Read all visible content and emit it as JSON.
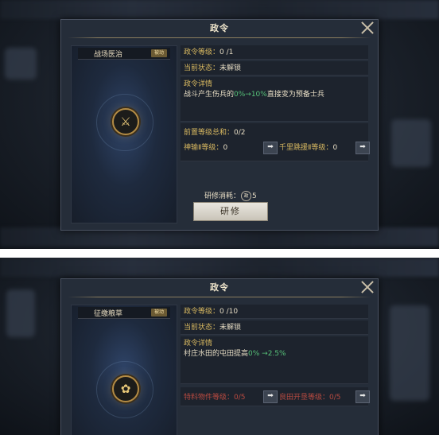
{
  "top": {
    "window_title": "政令",
    "policy_name": "战场医治",
    "policy_badge": "被动",
    "level_label": "政令等级：",
    "level_value": "0 /1",
    "status_label": "当前状态：",
    "status_value": "未解锁",
    "details_label": "政令详情",
    "details_prefix": "战斗产生伤兵的",
    "details_range": "0%→10%",
    "details_suffix": "直接变为预备士兵",
    "prereq_label": "前置等级总和：",
    "prereq_value": "0/2",
    "prereq1_label": "神输Ⅱ等级：",
    "prereq1_value": "0",
    "prereq2_label": "千里跳援Ⅱ等级：",
    "prereq2_value": "0",
    "arrow": "➡",
    "cost_label": "研修消耗：",
    "cost_icon": "政",
    "cost_value": "5",
    "study_button": "研修"
  },
  "bottom": {
    "window_title": "政令",
    "policy_name": "征缴粮草",
    "policy_badge": "被动",
    "level_label": "政令等级：",
    "level_value": "0 /10",
    "status_label": "当前状态：",
    "status_value": "未解锁",
    "details_label": "政令详情",
    "details_prefix": "村庄水田的屯田提高",
    "details_range": "0% →2.5%",
    "prereq1_label": "特料物件等级：",
    "prereq1_value": "0/5",
    "prereq2_label": "良田开垦等级：",
    "prereq2_value": "0/5",
    "arrow": "➡"
  },
  "colors": {
    "gold_label": "#d8b860",
    "green_value": "#56c078",
    "red_requirement": "#b84a40"
  }
}
